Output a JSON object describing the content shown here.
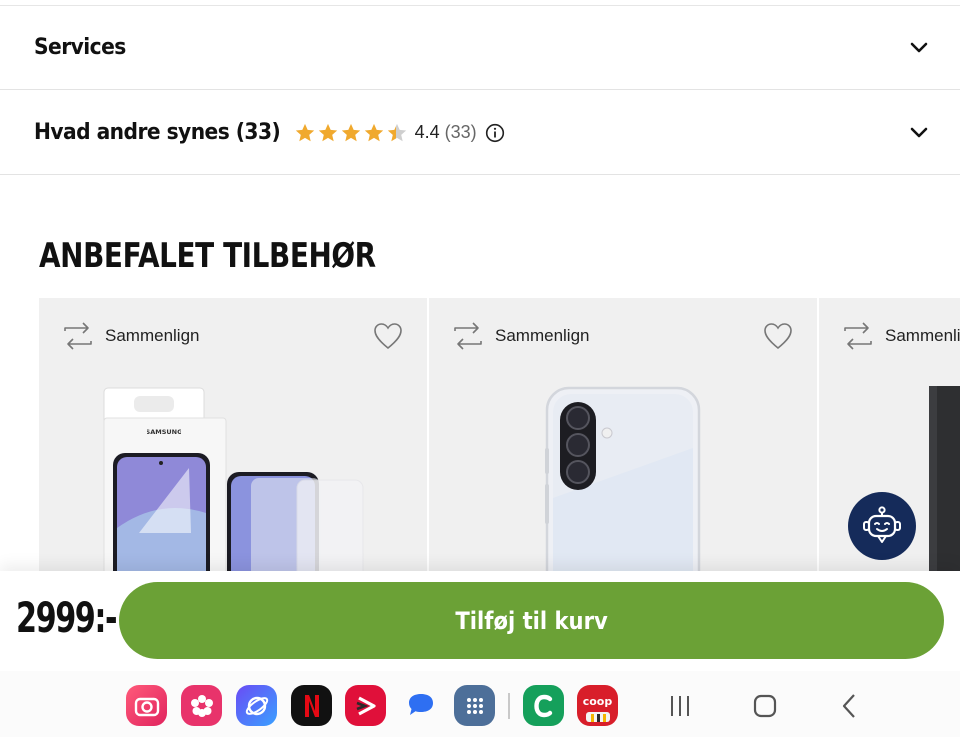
{
  "accordion": {
    "services": {
      "title": "Services"
    },
    "reviews": {
      "title": "Hvad andre synes (33)",
      "rating_value": "4.4",
      "rating_count": "(33)",
      "rating_stars": 4.4
    }
  },
  "recommended": {
    "title": "ANBEFALET TILBEHØR",
    "cards": [
      {
        "compare_label": "Sammenlign",
        "brand_text": "SAMSUNG"
      },
      {
        "compare_label": "Sammenlign"
      },
      {
        "compare_label": "Sammenlign"
      }
    ]
  },
  "purchase": {
    "price": "2999:-",
    "add_to_cart": "Tilføj til kurv"
  },
  "dock": {
    "apps": [
      "camera-app",
      "flower-app",
      "internet-app",
      "netflix-app",
      "viaplay-app",
      "messages-app",
      "app-drawer",
      "coop-c-app",
      "coop-app"
    ],
    "coop_label": "coop"
  },
  "colors": {
    "accent_green": "#6ba136",
    "star": "#f0a92e",
    "chatbot_bg": "#152b5a"
  }
}
